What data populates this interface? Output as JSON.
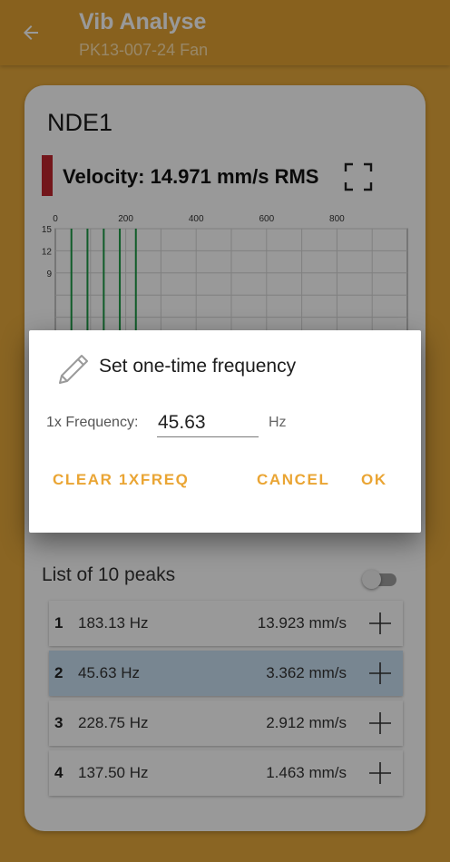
{
  "appbar": {
    "title": "Vib Analyse",
    "subtitle": "PK13-007-24 Fan"
  },
  "card": {
    "title": "NDE1",
    "velocity": "Velocity: 14.971 mm/s RMS",
    "indicator_color": "#c0262d"
  },
  "chart_data": {
    "type": "bar",
    "x_ticks": [
      "0",
      "200",
      "400",
      "600",
      "800"
    ],
    "y_ticks": [
      "15",
      "12",
      "9"
    ],
    "xlim": [
      0,
      1000
    ],
    "ylim": [
      0,
      15
    ],
    "grid": true,
    "line_color": "#1b9a45",
    "x": [
      45.63,
      91.3,
      137.5,
      183.13,
      228.75
    ],
    "values": [
      15,
      15,
      15,
      15,
      15
    ]
  },
  "peaks": {
    "title": "List of 10 peaks",
    "toggle_on": false,
    "items": [
      {
        "num": "1",
        "freq": "183.13 Hz",
        "amp": "13.923 mm/s"
      },
      {
        "num": "2",
        "freq": "45.63 Hz",
        "amp": "3.362 mm/s"
      },
      {
        "num": "3",
        "freq": "228.75 Hz",
        "amp": "2.912 mm/s"
      },
      {
        "num": "4",
        "freq": "137.50 Hz",
        "amp": "1.463 mm/s"
      }
    ]
  },
  "dialog": {
    "title": "Set one-time frequency",
    "field_label": "1x Frequency:",
    "field_value": "45.63",
    "unit": "Hz",
    "clear_label": "CLEAR 1XFREQ",
    "cancel_label": "CANCEL",
    "ok_label": "OK",
    "accent": "#eaa534"
  }
}
